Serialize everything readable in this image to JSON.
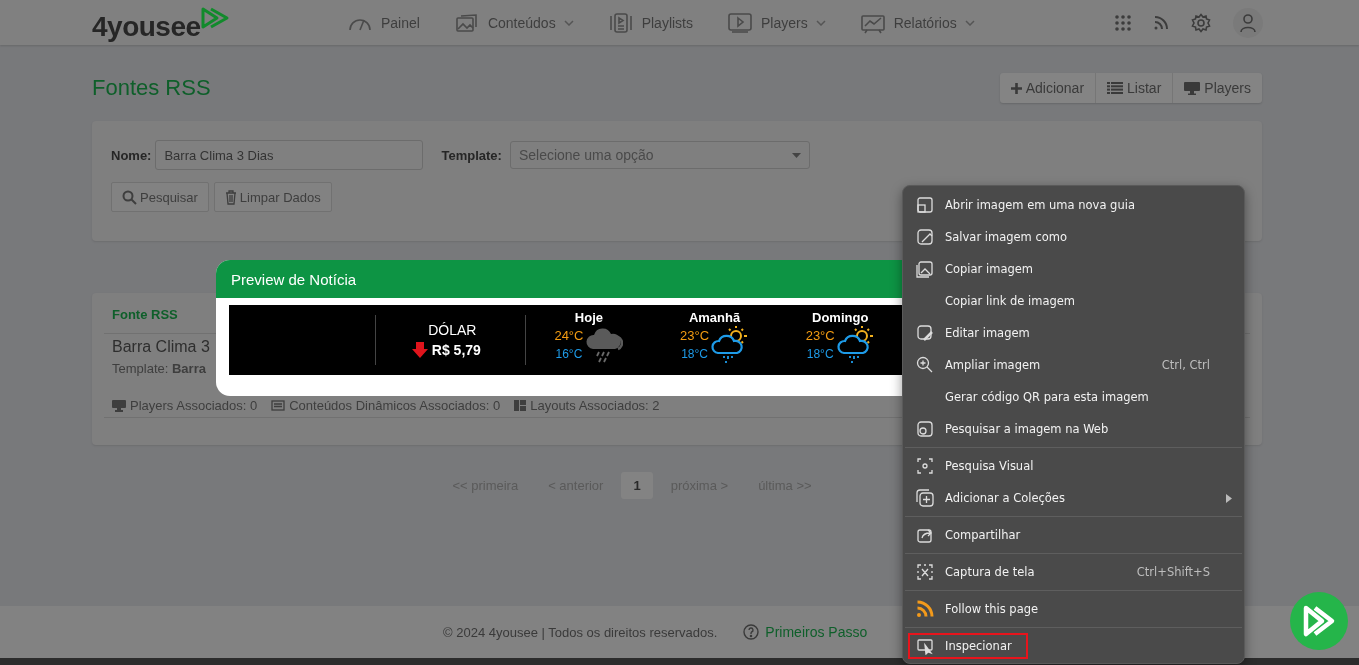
{
  "header": {
    "logo": "4yousee",
    "nav": [
      {
        "label": "Painel",
        "dropdown": false
      },
      {
        "label": "Conteúdos",
        "dropdown": true
      },
      {
        "label": "Playlists",
        "dropdown": false
      },
      {
        "label": "Players",
        "dropdown": true
      },
      {
        "label": "Relatórios",
        "dropdown": true
      }
    ]
  },
  "title": "Fontes RSS",
  "actions": [
    "Adicionar",
    "Listar",
    "Players"
  ],
  "filter": {
    "name_label": "Nome:",
    "name_value": "Barra Clima 3 Dias",
    "template_label": "Template:",
    "template_placeholder": "Selecione uma opção",
    "buttons": [
      "Pesquisar",
      "Limpar Dados"
    ]
  },
  "list": {
    "heading": "Fonte RSS",
    "item": {
      "title": "Barra Clima 3",
      "template": "Template: **Barra**",
      "stats": [
        "Players Associados: 0",
        "Conteúdos Dinâmicos Associados: 0",
        "Layouts Associados: 2"
      ]
    }
  },
  "pagination": [
    {
      "label": "<< primeira",
      "selected": false
    },
    {
      "label": "< anterior",
      "selected": false
    },
    {
      "label": "1",
      "selected": true
    },
    {
      "label": "próxima >",
      "selected": false
    },
    {
      "label": "última >>",
      "selected": false
    }
  ],
  "footer": {
    "copyright": "© 2024 4yousee | Todos os direitos reservados.",
    "link": "Primeiros Passo"
  },
  "modal": {
    "title": "Preview de Notícia",
    "currency": {
      "label": "DÓLAR",
      "value": "R$ 5,79",
      "down": true
    },
    "days": [
      {
        "name": "Hoje",
        "high": "24°C",
        "low": "16°C",
        "kind": "rain"
      },
      {
        "name": "Amanhã",
        "high": "23°C",
        "low": "18°C",
        "kind": "partly"
      },
      {
        "name": "Domingo",
        "high": "23°C",
        "low": "18°C",
        "kind": "partly"
      }
    ]
  },
  "context_menu": [
    [
      {
        "label": "Abrir imagem em uma nova guia",
        "marked": false
      },
      {
        "label": "Salvar imagem como",
        "marked": false
      },
      {
        "label": "Copiar imagem",
        "marked": false
      },
      {
        "label": "Copiar link de imagem",
        "marked": false
      },
      {
        "label": "Editar imagem",
        "marked": false
      },
      {
        "label": "Ampliar imagem",
        "shortcut": "Ctrl, Ctrl",
        "marked": false
      },
      {
        "label": "Gerar código QR para esta imagem",
        "marked": false
      },
      {
        "label": "Pesquisar a imagem na Web",
        "marked": false
      }
    ],
    [
      {
        "label": "Pesquisa Visual",
        "marked": false
      },
      {
        "label": "Adicionar a Coleções",
        "submenu": true,
        "marked": false
      }
    ],
    [
      {
        "label": "Compartilhar",
        "marked": false
      }
    ],
    [
      {
        "label": "Captura de tela",
        "shortcut": "Ctrl+Shift+S",
        "marked": false
      }
    ],
    [
      {
        "label": "Follow this page",
        "marked": false
      }
    ],
    [
      {
        "label": "Inspecionar",
        "marked": true
      }
    ]
  ]
}
